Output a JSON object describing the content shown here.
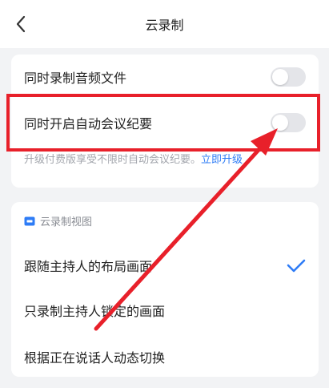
{
  "header": {
    "title": "云录制"
  },
  "settings": {
    "audio_file_label": "同时录制音频文件",
    "audio_file_on": false,
    "meeting_summary_label": "同时开启自动会议纪要",
    "meeting_summary_on": false,
    "hint_text": "升级付费版享受不限时自动会议纪要。",
    "hint_link": "立即升级"
  },
  "view": {
    "section_title": "云录制视图",
    "options": [
      {
        "label": "跟随主持人的布局画面",
        "selected": true
      },
      {
        "label": "只录制主持人锁定的画面",
        "selected": false
      },
      {
        "label": "根据正在说话人动态切换",
        "selected": false
      }
    ]
  },
  "colors": {
    "accent": "#2e7cf6",
    "annotation": "#e8202a",
    "toggle_off": "#e4e5e9",
    "background": "#f2f3f5"
  }
}
